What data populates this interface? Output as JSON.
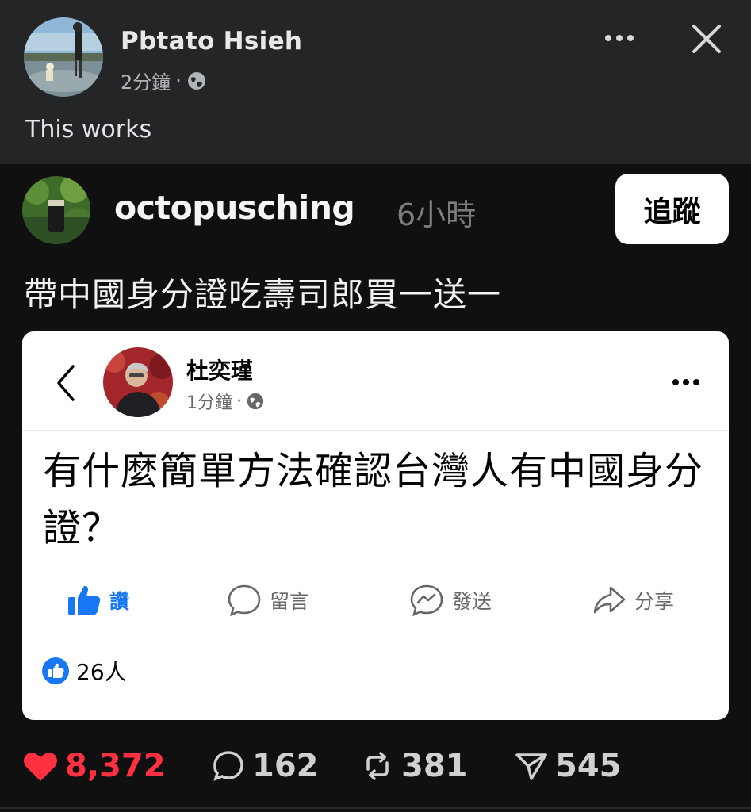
{
  "outer_post": {
    "author": "Pbtato Hsieh",
    "time": "2分鐘",
    "separator": "·",
    "caption": "This works",
    "icons": {
      "privacy": "globe-icon",
      "more": "more-horizontal-icon",
      "close": "close-icon"
    }
  },
  "threads_post": {
    "username": "octopusching",
    "time": "6小時",
    "follow_label": "追蹤",
    "text": "帶中國身分證吃壽司郎買一送一"
  },
  "embedded_post": {
    "author": "杜奕瑾",
    "time": "1分鐘",
    "separator": "·",
    "text": "有什麼簡單方法確認台灣人有中國身分證？",
    "actions": {
      "like": "讚",
      "comment": "留言",
      "send": "發送",
      "share": "分享"
    },
    "likes_count": "26人",
    "icons": {
      "back": "chevron-left-icon",
      "privacy": "globe-icon",
      "more": "more-horizontal-icon"
    }
  },
  "threads_stats": {
    "likes": "8,372",
    "comments": "162",
    "reposts": "381",
    "shares": "545"
  },
  "colors": {
    "outer_bg": "#242526",
    "threads_bg": "#101010",
    "heart": "#ff3040",
    "facebook_blue": "#1877f2"
  }
}
